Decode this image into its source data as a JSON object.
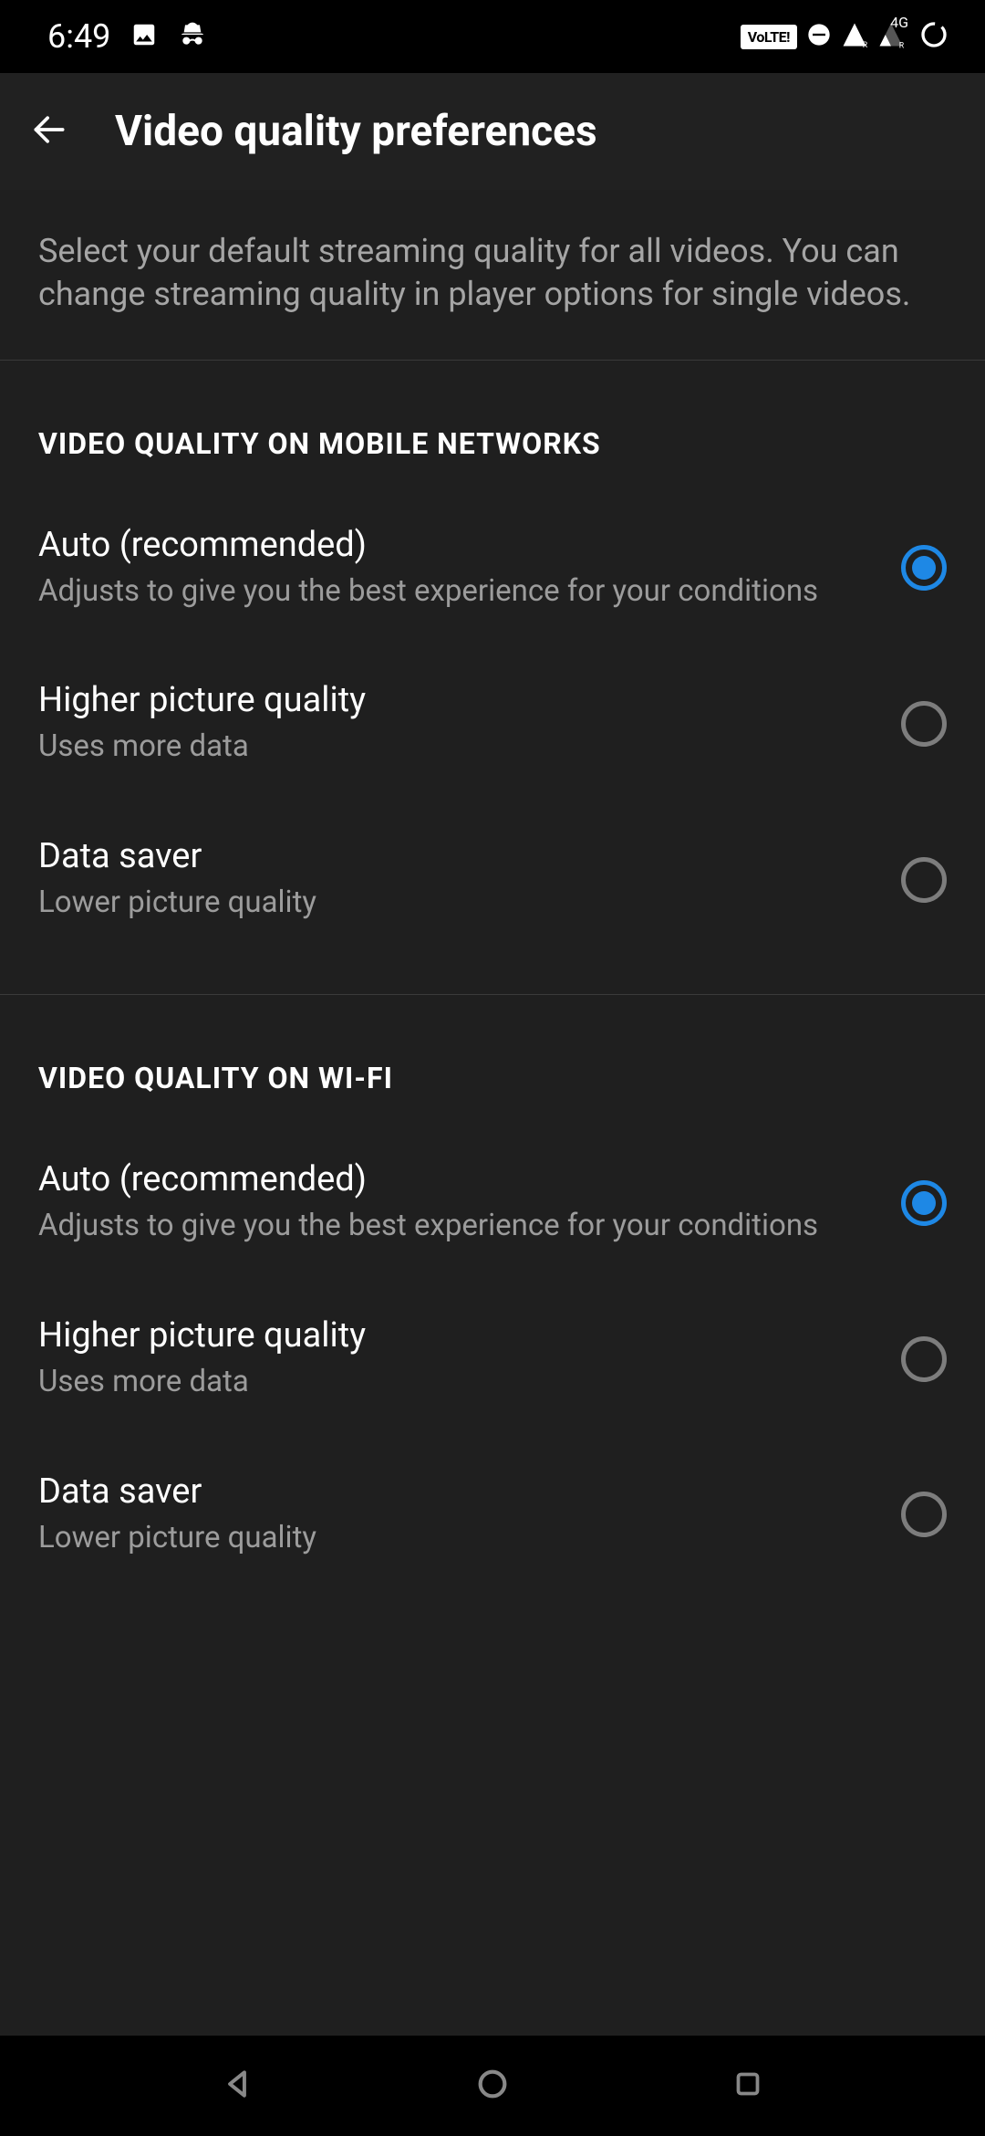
{
  "status": {
    "time": "6:49",
    "volte": "VoLTE!",
    "network_label": "4G"
  },
  "header": {
    "title": "Video quality preferences"
  },
  "description": "Select your default streaming quality for all videos. You can change streaming quality in player options for single videos.",
  "sections": [
    {
      "header": "VIDEO QUALITY ON MOBILE NETWORKS",
      "options": [
        {
          "title": "Auto (recommended)",
          "subtitle": "Adjusts to give you the best experience for your conditions",
          "selected": true
        },
        {
          "title": "Higher picture quality",
          "subtitle": "Uses more data",
          "selected": false
        },
        {
          "title": "Data saver",
          "subtitle": "Lower picture quality",
          "selected": false
        }
      ]
    },
    {
      "header": "VIDEO QUALITY ON WI-FI",
      "options": [
        {
          "title": "Auto (recommended)",
          "subtitle": "Adjusts to give you the best experience for your conditions",
          "selected": true
        },
        {
          "title": "Higher picture quality",
          "subtitle": "Uses more data",
          "selected": false
        },
        {
          "title": "Data saver",
          "subtitle": "Lower picture quality",
          "selected": false
        }
      ]
    }
  ]
}
